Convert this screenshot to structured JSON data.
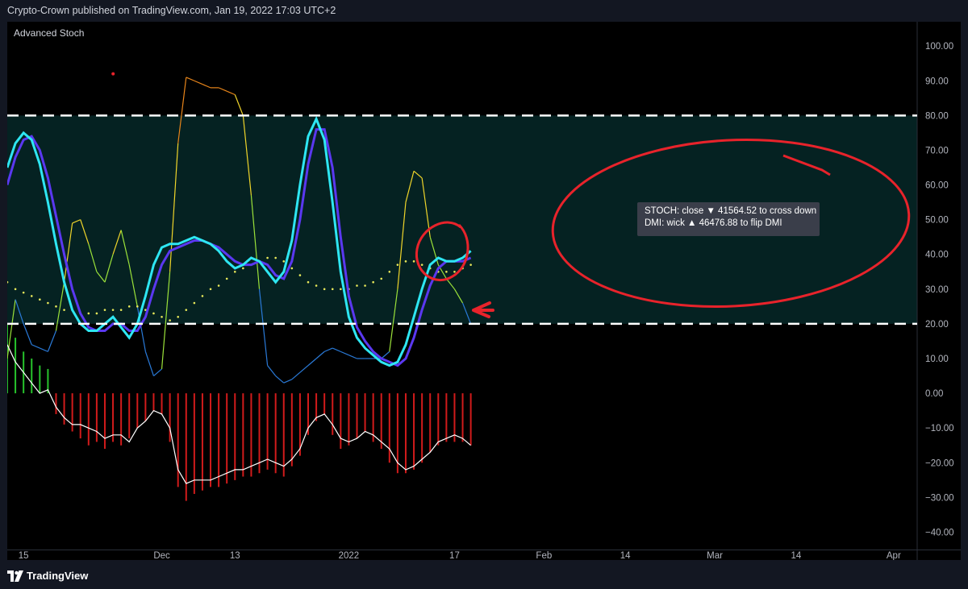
{
  "header": {
    "publish_text": "Crypto-Crown published on TradingView.com, Jan 19, 2022 17:03 UTC+2"
  },
  "footer": {
    "brand": "TradingView"
  },
  "colors": {
    "background": "#000000",
    "frame": "#131722",
    "stoch_k": "#2ee6f2",
    "stoch_d": "#5a38f0",
    "band_fill": "#052222",
    "guide": "#ffffff",
    "hist_pos": "#27c32c",
    "hist_neg": "#d11b1b",
    "annotation": "#e8232b"
  },
  "chart_data": {
    "type": "line",
    "title": "",
    "indicator": "Advanced Stoch",
    "ylim": [
      -45,
      107
    ],
    "y_ticks": [
      "100.00",
      "90.00",
      "80.00",
      "70.00",
      "60.00",
      "50.00",
      "40.00",
      "30.00",
      "20.00",
      "10.00",
      "0.00",
      "−10.00",
      "−20.00",
      "−30.00",
      "−40.00"
    ],
    "y_tick_values": [
      100,
      90,
      80,
      70,
      60,
      50,
      40,
      30,
      20,
      10,
      0,
      -10,
      -20,
      -30,
      -40
    ],
    "x_ticks": [
      "15",
      "Dec",
      "13",
      "2022",
      "17",
      "Feb",
      "14",
      "Mar",
      "14",
      "Apr"
    ],
    "x_tick_index": [
      2,
      19,
      28,
      42,
      55,
      66,
      76,
      87,
      97,
      109
    ],
    "x_count": 112,
    "levels": [
      80,
      20
    ],
    "series": [
      {
        "name": "",
        "role": "stoch_k",
        "color": "#2ee6f2",
        "start": 0,
        "values": [
          65,
          72,
          75,
          73,
          66,
          55,
          43,
          32,
          24,
          20,
          18,
          18,
          20,
          22,
          19,
          16,
          20,
          28,
          37,
          42,
          43,
          43,
          44,
          45,
          44,
          43,
          41,
          38,
          36,
          37,
          39,
          38,
          35,
          32,
          35,
          44,
          60,
          74,
          79,
          73,
          55,
          35,
          22,
          16,
          13,
          11,
          9,
          8,
          9,
          14,
          22,
          30,
          37,
          39,
          38,
          38,
          39,
          41
        ]
      },
      {
        "name": "",
        "role": "stoch_d",
        "color": "#5a38f0",
        "start": 0,
        "values": [
          60,
          68,
          73,
          74,
          70,
          62,
          51,
          40,
          30,
          23,
          19,
          18,
          18,
          20,
          20,
          18,
          18,
          22,
          30,
          37,
          41,
          42,
          43,
          44,
          44,
          43,
          42,
          40,
          38,
          37,
          37,
          38,
          37,
          34,
          33,
          38,
          50,
          66,
          76,
          76,
          65,
          45,
          28,
          19,
          15,
          12,
          10,
          9,
          8,
          10,
          16,
          24,
          31,
          36,
          38,
          38,
          38,
          39
        ]
      },
      {
        "name": "",
        "role": "dmi_line",
        "colors": [
          "#2a7ad8",
          "#9be23a",
          "#f0d52a",
          "#e8851a"
        ],
        "start": 0,
        "values": [
          10,
          27,
          20,
          14,
          13,
          12,
          18,
          32,
          49,
          50,
          43,
          35,
          32,
          40,
          47,
          37,
          25,
          12,
          5,
          7,
          35,
          72,
          91,
          90,
          89,
          88,
          88,
          87,
          86,
          80,
          57,
          30,
          8,
          5,
          3,
          4,
          6,
          8,
          10,
          12,
          13,
          12,
          11,
          10,
          10,
          10,
          10,
          12,
          30,
          55,
          64,
          62,
          45,
          37,
          33,
          30,
          26,
          20
        ]
      },
      {
        "name": "",
        "role": "signal_dots",
        "color": "#e8e85a",
        "start": 0,
        "values": [
          32,
          30,
          29,
          28,
          27,
          26,
          25,
          24,
          24,
          23,
          23,
          23,
          24,
          24,
          24,
          25,
          25,
          24,
          23,
          22,
          21,
          22,
          24,
          26,
          28,
          30,
          31,
          33,
          35,
          36,
          37,
          38,
          39,
          39,
          38,
          36,
          34,
          32,
          31,
          30,
          30,
          30,
          30,
          31,
          31,
          32,
          33,
          35,
          37,
          38,
          38,
          37,
          36,
          35,
          35,
          35,
          36,
          37
        ]
      },
      {
        "name": "",
        "role": "momentum_line",
        "color": "#ffffff",
        "start": 0,
        "values": [
          14,
          9,
          6,
          3,
          0,
          1,
          -4,
          -7,
          -9,
          -9,
          -10,
          -11,
          -13,
          -12,
          -12,
          -14,
          -10,
          -8,
          -5,
          -6,
          -10,
          -22,
          -26,
          -25,
          -25,
          -25,
          -24,
          -23,
          -22,
          -22,
          -21,
          -20,
          -19,
          -20,
          -21,
          -19,
          -16,
          -10,
          -7,
          -6,
          -9,
          -13,
          -14,
          -13,
          -11,
          -12,
          -14,
          -16,
          -20,
          -22,
          -21,
          -19,
          -17,
          -14,
          -13,
          -12,
          -13,
          -15
        ]
      },
      {
        "name": "",
        "role": "histogram",
        "start": 0,
        "values": [
          20,
          16,
          12,
          10,
          8,
          7,
          -6,
          -9,
          -11,
          -13,
          -15,
          -14,
          -16,
          -14,
          -15,
          -13,
          -10,
          -8,
          -5,
          -6,
          -14,
          -27,
          -31,
          -29,
          -28,
          -27,
          -27,
          -26,
          -25,
          -24,
          -24,
          -23,
          -22,
          -23,
          -24,
          -21,
          -18,
          -12,
          -8,
          -6,
          -12,
          -16,
          -15,
          -13,
          -11,
          -14,
          -16,
          -20,
          -23,
          -23,
          -22,
          -20,
          -17,
          -15,
          -14,
          -14,
          -14,
          -15
        ]
      }
    ],
    "top_dot": {
      "x": 15,
      "y": 92
    },
    "annotations": {
      "line1": "STOCH: close ▼ 41564.52 to cross down",
      "line2": "DMI: wick ▲ 46476.88 to flip DMI"
    }
  }
}
